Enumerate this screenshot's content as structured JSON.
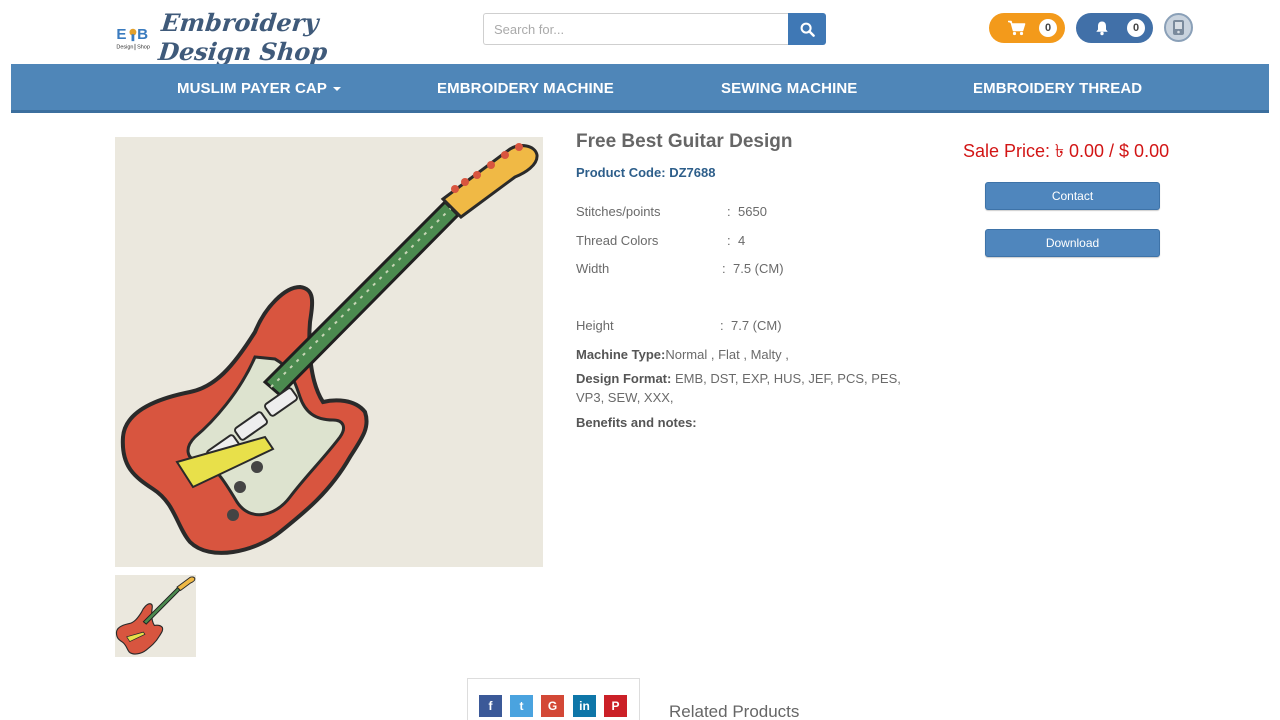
{
  "header": {
    "logo_text": "Embroidery Design Shop",
    "search_placeholder": "Search for...",
    "cart_count": "0",
    "notification_count": "0"
  },
  "nav": {
    "items": [
      "MUSLIM PAYER CAP",
      "EMBROIDERY MACHINE",
      "SEWING MACHINE",
      "EMBROIDERY THREAD"
    ]
  },
  "product": {
    "title": "Free Best Guitar Design",
    "code_label": "Product Code:",
    "code": "DZ7688",
    "specs": [
      {
        "label": "Stitches/points",
        "value": "5650"
      },
      {
        "label": "Thread Colors",
        "value": "4"
      },
      {
        "label": "Width",
        "value": "7.5 (CM)"
      },
      {
        "label": "Height",
        "value": "7.7 (CM)"
      }
    ],
    "machine_type_label": "Machine Type:",
    "machine_type": "Normal , Flat , Malty ,",
    "design_format_label": "Design Format:",
    "design_format": "EMB, DST, EXP, HUS, JEF, PCS, PES, VP3, SEW, XXX,",
    "benefits_label": "Benefits and notes:"
  },
  "sale": {
    "text": "Sale Price: ৳ 0.00 / $ 0.00"
  },
  "buttons": {
    "contact": "Contact",
    "download": "Download"
  },
  "share": {
    "facebook": "f",
    "twitter": "t",
    "google": "G",
    "linkedin": "in",
    "pinterest": "P"
  },
  "related_title": "Related Products",
  "colors": {
    "nav": "#4f86b8",
    "cart": "#f39a1b",
    "bell": "#4170a8",
    "sale": "#d21515",
    "button": "#4f86bd"
  }
}
